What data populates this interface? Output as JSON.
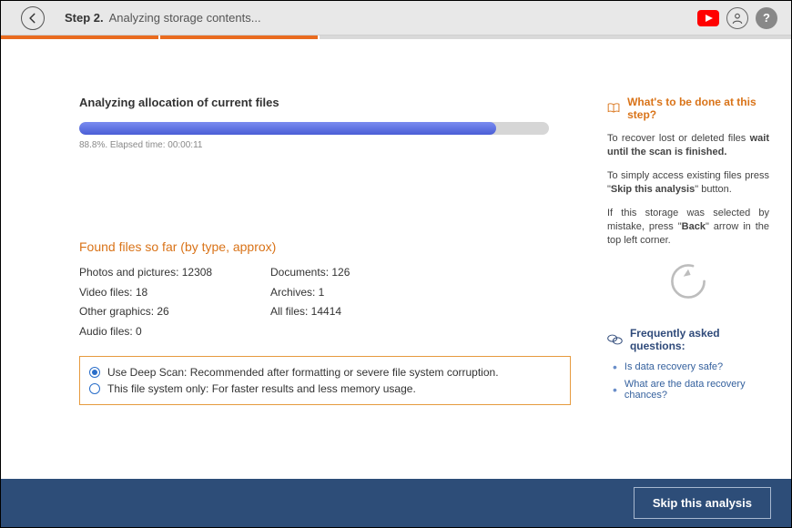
{
  "header": {
    "step_label": "Step 2.",
    "step_desc": "Analyzing storage contents..."
  },
  "progress": {
    "title": "Analyzing allocation of current files",
    "percent": 88.8,
    "subtext": "88.8%. Elapsed time: 00:00:11"
  },
  "found": {
    "heading": "Found files so far (by type, approx)",
    "col1": {
      "photos": "Photos and pictures: 12308",
      "video": "Video files: 18",
      "other": "Other graphics: 26",
      "audio": "Audio files: 0"
    },
    "col2": {
      "docs": "Documents: 126",
      "archives": "Archives: 1",
      "all": "All files: 14414"
    }
  },
  "options": {
    "deep": "Use Deep Scan: Recommended after formatting or severe file system corruption.",
    "fs_only": "This file system only: For faster results and less memory usage."
  },
  "help": {
    "heading": "What's to be done at this step?",
    "p1_a": "To recover lost or deleted files ",
    "p1_b": "wait until the scan is finished.",
    "p2_a": "To simply access existing files press \"",
    "p2_b": "Skip this analysis",
    "p2_c": "\" button.",
    "p3_a": "If this storage was selected by mistake, press \"",
    "p3_b": "Back",
    "p3_c": "\" arrow in the top left corner."
  },
  "faq": {
    "heading": "Frequently asked questions:",
    "q1": "Is data recovery safe?",
    "q2": "What are the data recovery chances?"
  },
  "footer": {
    "skip": "Skip this analysis"
  }
}
